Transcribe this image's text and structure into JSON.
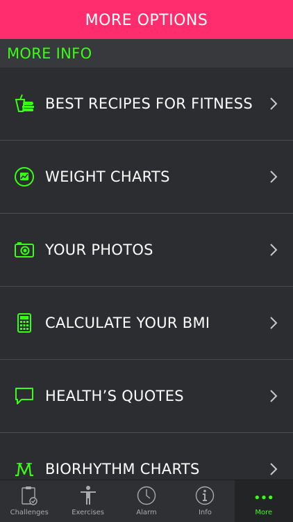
{
  "header": {
    "title": "MORE OPTIONS"
  },
  "section": {
    "title": "MORE INFO"
  },
  "menu": [
    {
      "label": "BEST RECIPES FOR FITNESS",
      "icon": "food-icon"
    },
    {
      "label": "WEIGHT CHARTS",
      "icon": "chart-icon"
    },
    {
      "label": "YOUR PHOTOS",
      "icon": "camera-icon"
    },
    {
      "label": "CALCULATE YOUR BMI",
      "icon": "calculator-icon"
    },
    {
      "label": "HEALTH’S QUOTES",
      "icon": "speech-bubble-icon"
    },
    {
      "label": "BIORHYTHM CHARTS",
      "icon": "biorhythm-icon"
    }
  ],
  "tabs": [
    {
      "label": "Challenges",
      "icon": "clipboard-check-icon"
    },
    {
      "label": "Exercises",
      "icon": "person-icon"
    },
    {
      "label": "Alarm",
      "icon": "clock-icon"
    },
    {
      "label": "Info",
      "icon": "info-icon"
    },
    {
      "label": "More",
      "icon": "more-dots-icon",
      "active": true
    }
  ],
  "colors": {
    "header_bg": "#ff2d6d",
    "accent_green": "#39ff14",
    "background": "#2b2d30"
  }
}
